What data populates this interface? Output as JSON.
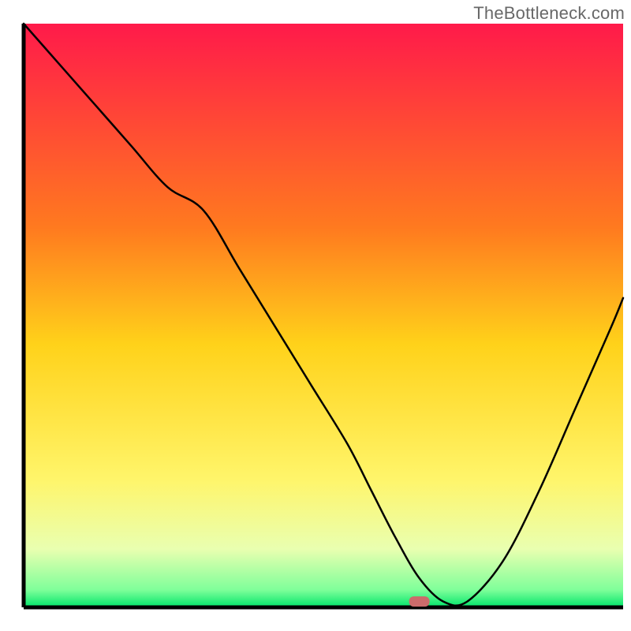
{
  "watermark": "TheBottleneck.com",
  "chart_data": {
    "type": "line",
    "title": "",
    "xlabel": "",
    "ylabel": "",
    "xlim": [
      0,
      100
    ],
    "ylim": [
      0,
      100
    ],
    "series": [
      {
        "name": "bottleneck-curve",
        "x": [
          0,
          6,
          12,
          18,
          24,
          30,
          36,
          42,
          48,
          54,
          58,
          62,
          66,
          70,
          74,
          80,
          86,
          92,
          98,
          100
        ],
        "y": [
          100,
          93,
          86,
          79,
          72,
          68,
          58,
          48,
          38,
          28,
          20,
          12,
          5,
          1,
          1,
          8,
          20,
          34,
          48,
          53
        ]
      }
    ],
    "marker": {
      "x": 66,
      "y": 1
    },
    "gradient_stops": [
      {
        "offset": 0,
        "color": "#ff1a4a"
      },
      {
        "offset": 35,
        "color": "#ff7a1f"
      },
      {
        "offset": 55,
        "color": "#ffd21a"
      },
      {
        "offset": 78,
        "color": "#fff56a"
      },
      {
        "offset": 90,
        "color": "#e9ffb0"
      },
      {
        "offset": 97,
        "color": "#7fff9a"
      },
      {
        "offset": 100,
        "color": "#00e56a"
      }
    ],
    "axis_color": "#000000",
    "line_color": "#000000",
    "marker_color": "#cc6b6b"
  }
}
